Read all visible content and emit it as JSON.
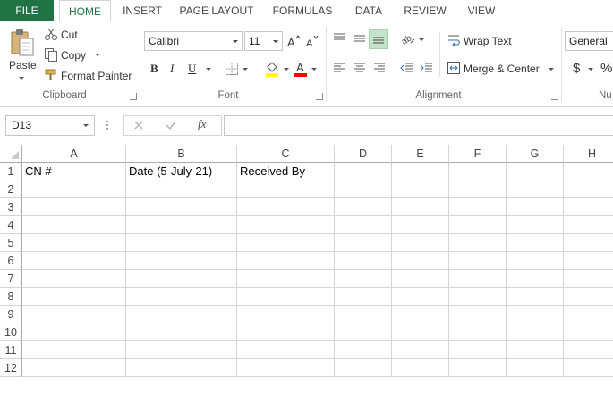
{
  "tabs": [
    "FILE",
    "HOME",
    "INSERT",
    "PAGE LAYOUT",
    "FORMULAS",
    "DATA",
    "REVIEW",
    "VIEW"
  ],
  "active_tab": "HOME",
  "clipboard": {
    "paste_label": "Paste",
    "cut_label": "Cut",
    "copy_label": "Copy",
    "format_painter_label": "Format Painter",
    "group_label": "Clipboard"
  },
  "font": {
    "name": "Calibri",
    "size": "11",
    "bold": "B",
    "italic": "I",
    "underline": "U",
    "group_label": "Font",
    "fill_color": "#ffff00",
    "font_color": "#ff0000"
  },
  "alignment": {
    "wrap_text_label": "Wrap Text",
    "merge_center_label": "Merge & Center",
    "group_label": "Alignment"
  },
  "number": {
    "format": "General",
    "currency": "$",
    "percent": "%",
    "group_label": "Nu"
  },
  "formula_bar": {
    "name_box": "D13",
    "fx": "fx",
    "value": ""
  },
  "columns": [
    "A",
    "B",
    "C",
    "D",
    "E",
    "F",
    "G",
    "H"
  ],
  "rows": [
    "1",
    "2",
    "3",
    "4",
    "5",
    "6",
    "7",
    "8",
    "9",
    "10",
    "11",
    "12"
  ],
  "cells": {
    "A1": "CN #",
    "B1": "Date (5-July-21)",
    "C1": "Received By"
  },
  "accent": "#217346"
}
